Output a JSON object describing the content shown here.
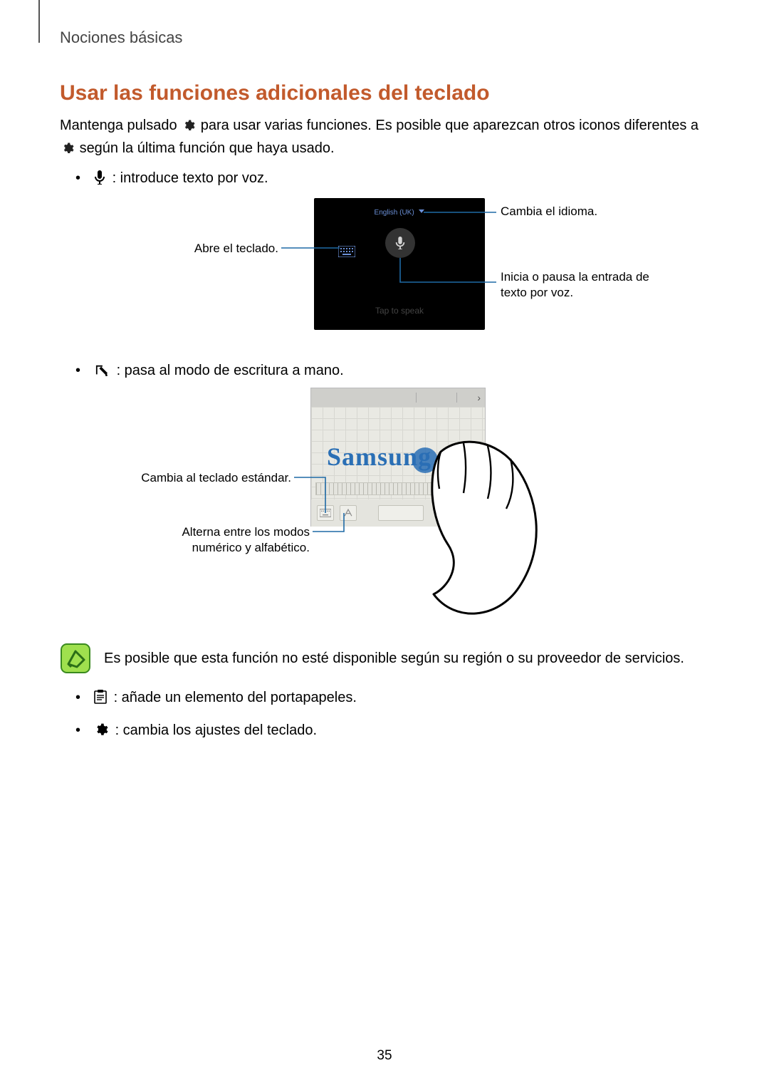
{
  "breadcrumb": "Nociones básicas",
  "heading": "Usar las funciones adicionales del teclado",
  "intro_a": "Mantenga pulsado",
  "intro_b": "para usar varias funciones. Es posible que aparezcan otros iconos diferentes a",
  "intro_c": "según la última función que haya usado.",
  "bullets": {
    "voice": ": introduce texto por voz.",
    "handwriting": ": pasa al modo de escritura a mano.",
    "clipboard": ": añade un elemento del portapapeles.",
    "settings": ": cambia los ajustes del teclado."
  },
  "fig1": {
    "language_label": "English (UK)",
    "tap_label": "Tap to speak",
    "callouts": {
      "open_keyboard": "Abre el teclado.",
      "change_lang": "Cambia el idioma.",
      "start_pause": "Inicia o pausa la entrada de texto por voz."
    }
  },
  "fig2": {
    "word": "Samsung",
    "callouts": {
      "std_keyboard": "Cambia al teclado estándar.",
      "toggle_mode": "Alterna entre los modos numérico y alfabético."
    }
  },
  "note": "Es posible que esta función no esté disponible según su región o su proveedor de servicios.",
  "page_number": "35"
}
